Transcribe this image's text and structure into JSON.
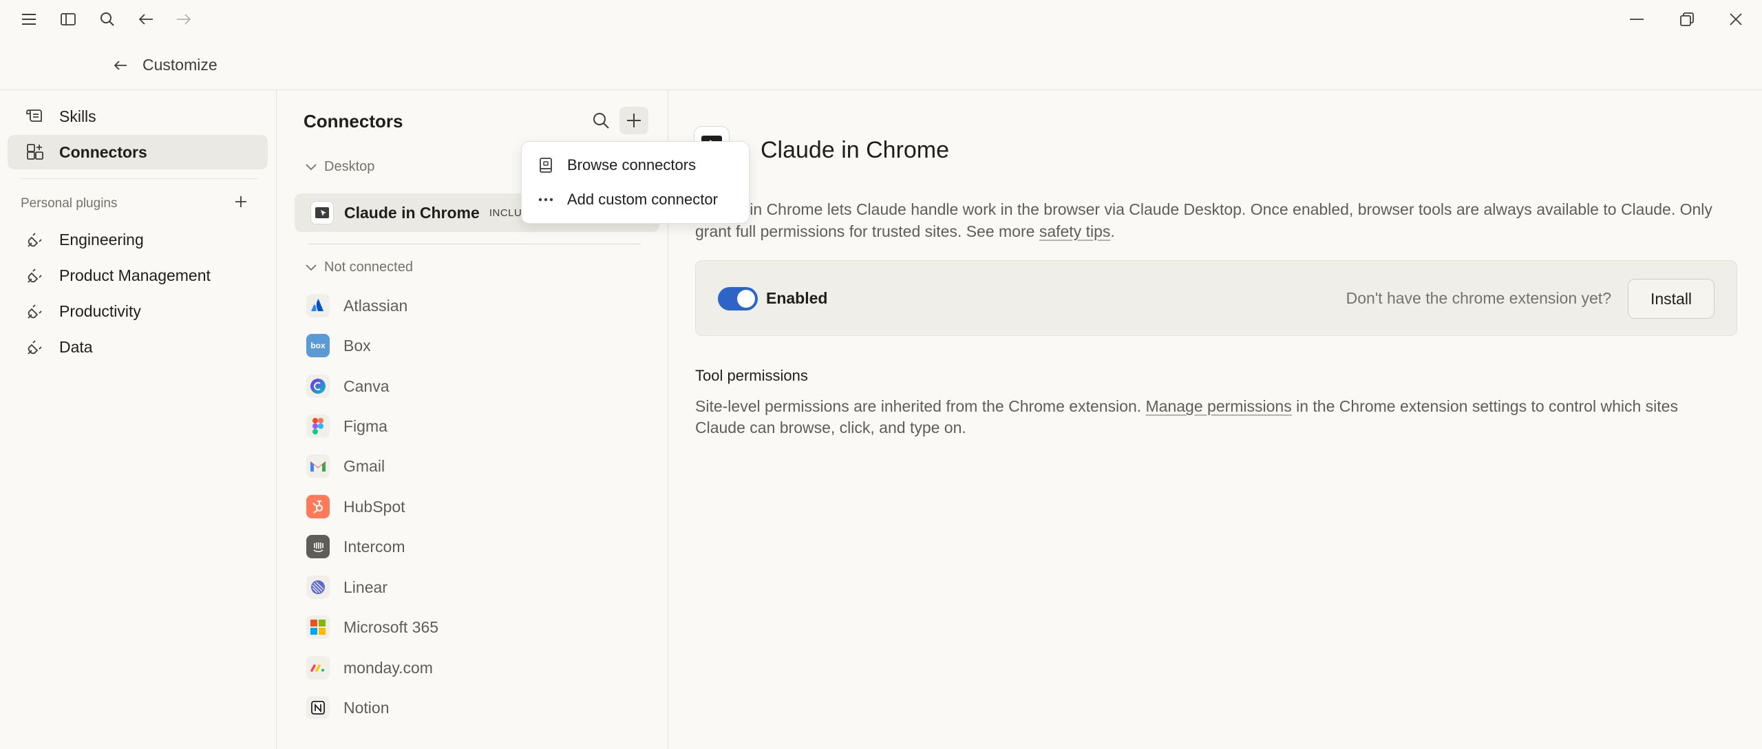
{
  "header": {
    "title": "Customize"
  },
  "sidebar": {
    "items": [
      {
        "label": "Skills",
        "icon": "scroll-icon"
      },
      {
        "label": "Connectors",
        "icon": "connectors-icon",
        "active": true
      }
    ],
    "section_label": "Personal plugins",
    "plugins": [
      {
        "label": "Engineering",
        "icon": "plug-icon"
      },
      {
        "label": "Product Management",
        "icon": "plug-icon"
      },
      {
        "label": "Productivity",
        "icon": "plug-icon"
      },
      {
        "label": "Data",
        "icon": "plug-icon"
      }
    ]
  },
  "middle": {
    "title": "Connectors",
    "desktop_group": "Desktop",
    "selected": {
      "name": "Claude in Chrome",
      "badge": "INCLU"
    },
    "not_connected_group": "Not connected",
    "connectors": [
      {
        "name": "Atlassian",
        "icon": "atlassian-logo-icon"
      },
      {
        "name": "Box",
        "icon": "box-logo-icon"
      },
      {
        "name": "Canva",
        "icon": "canva-logo-icon"
      },
      {
        "name": "Figma",
        "icon": "figma-logo-icon"
      },
      {
        "name": "Gmail",
        "icon": "gmail-logo-icon"
      },
      {
        "name": "HubSpot",
        "icon": "hubspot-logo-icon"
      },
      {
        "name": "Intercom",
        "icon": "intercom-logo-icon"
      },
      {
        "name": "Linear",
        "icon": "linear-logo-icon"
      },
      {
        "name": "Microsoft 365",
        "icon": "microsoft-logo-icon"
      },
      {
        "name": "monday.com",
        "icon": "monday-logo-icon"
      },
      {
        "name": "Notion",
        "icon": "notion-logo-icon"
      }
    ]
  },
  "dropdown": {
    "browse": "Browse connectors",
    "custom": "Add custom connector"
  },
  "detail": {
    "title": "Claude in Chrome",
    "desc_part1": "Claude in Chrome lets Claude handle work in the browser via Claude Desktop. Once enabled, browser tools are always available to Claude. Only grant full permissions for trusted sites. See more ",
    "desc_link": "safety tips",
    "desc_end": ".",
    "toggle_label": "Enabled",
    "toggle_on": true,
    "hint": "Don't have the chrome extension yet?",
    "install": "Install",
    "tp_title": "Tool permissions",
    "tp_part1": "Site-level permissions are inherited from the Chrome extension. ",
    "tp_link": "Manage permissions",
    "tp_part2": " in the Chrome extension settings to control which sites Claude can browse, click, and type on."
  },
  "colors": {
    "accent": "#2c64c8",
    "background": "#faf9f5",
    "active_bg": "#ebe9e3"
  }
}
